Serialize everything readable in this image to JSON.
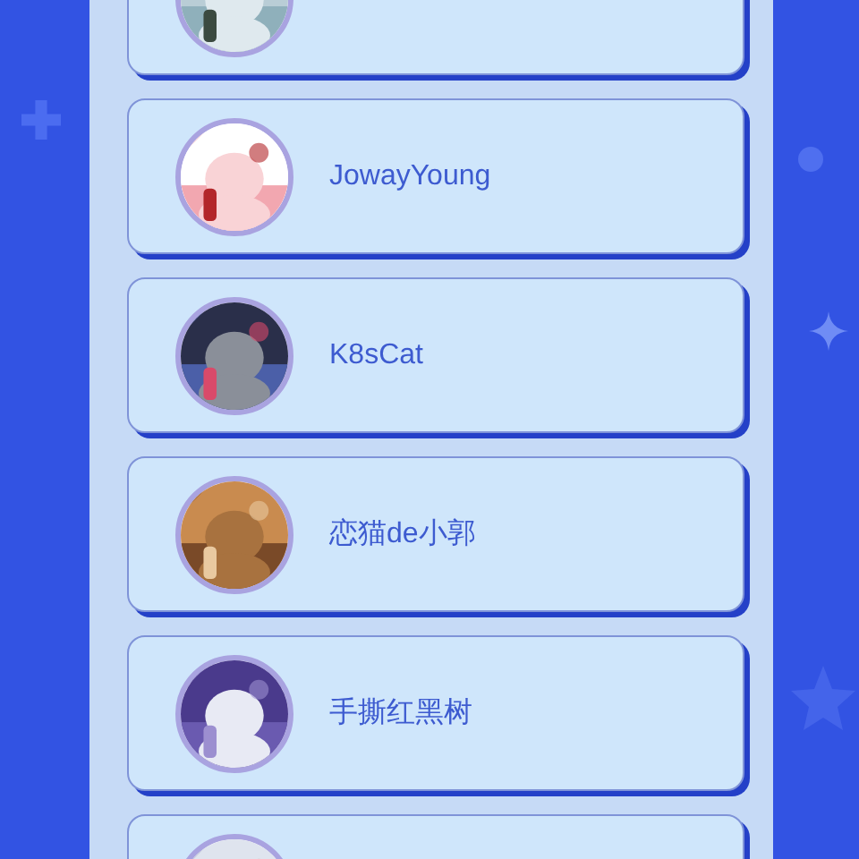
{
  "users": [
    {
      "kind": "picture-only"
    },
    {
      "kind": "named",
      "name": "JowayYoung"
    },
    {
      "kind": "named",
      "name": "K8sCat"
    },
    {
      "kind": "named",
      "name": "恋猫de小郭"
    },
    {
      "kind": "named",
      "name": "手撕红黑树"
    },
    {
      "kind": "picture-only"
    }
  ]
}
